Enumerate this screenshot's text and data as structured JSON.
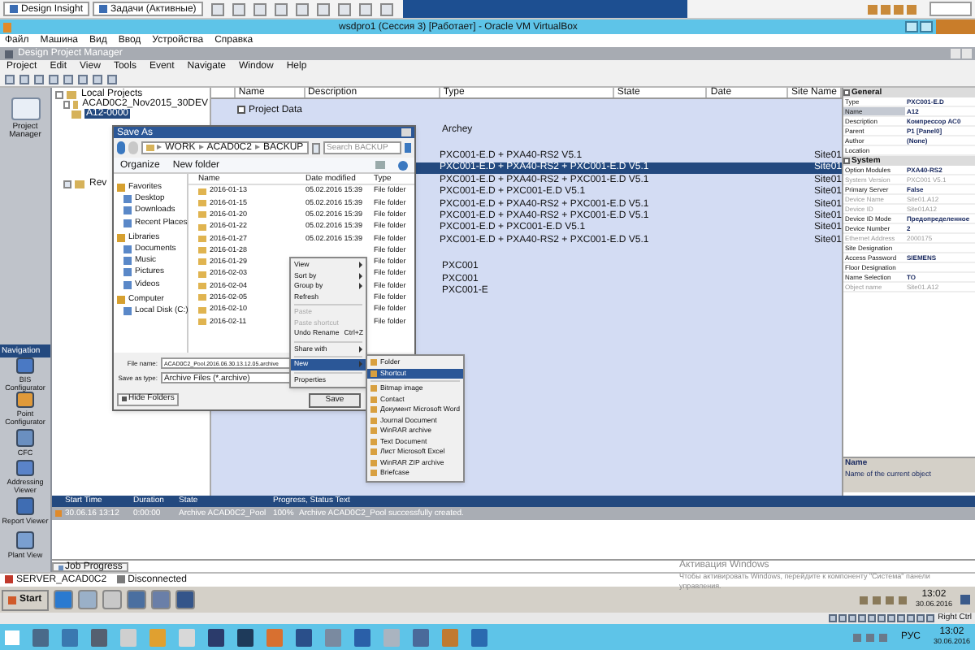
{
  "host_toolbar": {
    "buttons": [
      "Design Insight",
      "Задачи (Активные)"
    ]
  },
  "vm_window": {
    "title": "wsdpro1 (Сессия 3) [Работает] - Oracle VM VirtualBox",
    "menu": [
      "Файл",
      "Машина",
      "Вид",
      "Ввод",
      "Устройства",
      "Справка"
    ]
  },
  "app": {
    "title": "Design Project Manager",
    "menu": [
      "Project",
      "Edit",
      "View",
      "Tools",
      "Event",
      "Navigate",
      "Window",
      "Help"
    ]
  },
  "sidebar": {
    "top_item": "Project Manager",
    "title": "Navigation",
    "items": [
      "BIS Configurator",
      "Point Configurator",
      "CFC",
      "Addressing Viewer",
      "Report Viewer",
      "Plant View"
    ]
  },
  "project_tree": [
    {
      "label": "Local Projects",
      "expanded": true,
      "selected": false,
      "children": [
        {
          "label": "ACAD0C2_Nov2015_30DEV",
          "expanded": true,
          "selected": false,
          "children": [
            {
              "label": "A12-0000",
              "selected": true
            }
          ]
        },
        {
          "label": "Rev",
          "expanded": false,
          "selected": false
        }
      ]
    }
  ],
  "table": {
    "columns": [
      "Name",
      "Description",
      "Type",
      "State",
      "Date",
      "Site Name"
    ],
    "project_data": {
      "label": "Project Data",
      "checked": false
    },
    "row_groups": [
      [
        {
          "type": "Archey",
          "selected": false
        }
      ],
      [
        {
          "type": "PXC001-E.D + PXA40-RS2 V5.1",
          "site": "Site01",
          "selected": false
        },
        {
          "type": "PXC001-E.D + PXA40-RS2 + PXC001-E.D V5.1",
          "site": "Site01",
          "selected": true
        },
        {
          "type": "PXC001-E.D + PXA40-RS2 + PXC001-E.D V5.1",
          "site": "Site01",
          "selected": false
        },
        {
          "type": "PXC001-E.D + PXC001-E.D V5.1",
          "site": "Site01",
          "selected": false
        },
        {
          "type": "PXC001-E.D + PXA40-RS2 + PXC001-E.D V5.1",
          "site": "Site01",
          "selected": false
        },
        {
          "type": "PXC001-E.D + PXA40-RS2 + PXC001-E.D V5.1",
          "site": "Site01",
          "selected": false
        },
        {
          "type": "PXC001-E.D + PXC001-E.D V5.1",
          "site": "Site01",
          "selected": false
        },
        {
          "type": "PXC001-E.D + PXA40-RS2 + PXC001-E.D V5.1",
          "site": "Site01",
          "selected": false
        }
      ],
      [
        {
          "type": "PXC001",
          "selected": false
        },
        {
          "type": "PXC001",
          "selected": false
        },
        {
          "type": "PXC001-E",
          "selected": false
        }
      ]
    ]
  },
  "properties": {
    "sections": [
      {
        "title": "General",
        "expanded": true,
        "rows": [
          {
            "label": "Type",
            "value": "PXC001-E.D",
            "selected": false,
            "disabled": false
          },
          {
            "label": "Name",
            "value": "A12",
            "selected": true,
            "disabled": false
          },
          {
            "label": "Description",
            "value": "Компрессор АС0",
            "selected": false,
            "disabled": false
          },
          {
            "label": "Parent",
            "value": "P1 [Panel0]",
            "selected": false,
            "disabled": false
          },
          {
            "label": "Author",
            "value": "(None)",
            "selected": false,
            "disabled": false
          },
          {
            "label": "Location",
            "selected": false,
            "disabled": false
          }
        ]
      },
      {
        "title": "System",
        "expanded": true,
        "rows": [
          {
            "label": "Option Modules",
            "value": "PXA40-RS2",
            "selected": false,
            "disabled": false
          },
          {
            "label": "System Version",
            "value": "PXC001 V5.1",
            "selected": false,
            "disabled": true
          },
          {
            "label": "Primary Server",
            "value": "False",
            "selected": false,
            "disabled": false
          },
          {
            "label": "Device Name",
            "value": "Site01.A12",
            "selected": false,
            "disabled": true
          },
          {
            "label": "Device ID",
            "value": "Site01A12",
            "selected": false,
            "disabled": true
          },
          {
            "label": "Device ID Mode",
            "value": "Предопределенное",
            "selected": false,
            "disabled": false
          },
          {
            "label": "Device Number",
            "value": "2",
            "selected": false,
            "disabled": false
          },
          {
            "label": "Ethernet Address",
            "value": "2000175",
            "selected": false,
            "disabled": true
          },
          {
            "label": "Site Designation",
            "selected": false,
            "disabled": false
          },
          {
            "label": "Access Password",
            "value": "SIEMENS",
            "selected": false,
            "disabled": false
          },
          {
            "label": "Floor Designation",
            "selected": false,
            "disabled": false
          },
          {
            "label": "Name Selection",
            "value": "TO",
            "selected": false,
            "disabled": false
          },
          {
            "label": "Object name",
            "value": "Site01.A12",
            "selected": false,
            "disabled": true
          }
        ]
      }
    ],
    "description": {
      "title": "Name",
      "text": "Name of the current object"
    }
  },
  "save_dialog": {
    "title": "Save As",
    "path": [
      "WORK",
      "ACAD0C2",
      "BACKUP"
    ],
    "path_separator": "▸",
    "search": {
      "placeholder": "Search BACKUP"
    },
    "toolbar": [
      "Organize",
      "New folder"
    ],
    "nav": [
      {
        "label": "Favorites",
        "kind": "group"
      },
      {
        "label": "Desktop",
        "kind": "item"
      },
      {
        "label": "Downloads",
        "kind": "item"
      },
      {
        "label": "Recent Places",
        "kind": "item"
      },
      {
        "label": "Libraries",
        "kind": "group"
      },
      {
        "label": "Documents",
        "kind": "item"
      },
      {
        "label": "Music",
        "kind": "item"
      },
      {
        "label": "Pictures",
        "kind": "item"
      },
      {
        "label": "Videos",
        "kind": "item"
      },
      {
        "label": "Computer",
        "kind": "group"
      },
      {
        "label": "Local Disk (C:)",
        "kind": "item"
      }
    ],
    "columns": [
      "Name",
      "Date modified",
      "Type"
    ],
    "files": [
      {
        "name": "2016-01-13",
        "date": "05.02.2016 15:39",
        "type": "File folder"
      },
      {
        "name": "2016-01-15",
        "date": "05.02.2016 15:39",
        "type": "File folder"
      },
      {
        "name": "2016-01-20",
        "date": "05.02.2016 15:39",
        "type": "File folder"
      },
      {
        "name": "2016-01-22",
        "date": "05.02.2016 15:39",
        "type": "File folder"
      },
      {
        "name": "2016-01-27",
        "date": "05.02.2016 15:39",
        "type": "File folder"
      },
      {
        "name": "2016-01-28",
        "type": "File folder"
      },
      {
        "name": "2016-01-29",
        "type": "File folder"
      },
      {
        "name": "2016-02-03",
        "type": "File folder"
      },
      {
        "name": "2016-02-04",
        "type": "File folder"
      },
      {
        "name": "2016-02-05",
        "type": "File folder"
      },
      {
        "name": "2016-02-10",
        "type": "File folder"
      },
      {
        "name": "2016-02-11",
        "type": "File folder"
      }
    ],
    "file_name_label": "File name:",
    "file_name": "ACAD0C2_Pool.2016.06.30.13.12.05.archive",
    "type_label": "Save as type:",
    "save_type": "Archive Files (*.archive)",
    "hide_folders": "Hide Folders",
    "save": "Save"
  },
  "context_menu": [
    {
      "label": "View",
      "kind": "submenu",
      "selected": false,
      "disabled": false
    },
    {
      "label": "Sort by",
      "kind": "submenu",
      "selected": false,
      "disabled": false
    },
    {
      "label": "Group by",
      "kind": "submenu",
      "selected": false,
      "disabled": false
    },
    {
      "label": "Refresh",
      "kind": "item",
      "selected": false,
      "disabled": false
    },
    {
      "kind": "separator"
    },
    {
      "label": "Paste",
      "kind": "item",
      "selected": false,
      "disabled": true
    },
    {
      "label": "Paste shortcut",
      "kind": "item",
      "selected": false,
      "disabled": true
    },
    {
      "label": "Undo Rename",
      "shortcut": "Ctrl+Z",
      "kind": "item",
      "selected": false,
      "disabled": false
    },
    {
      "kind": "separator"
    },
    {
      "label": "Share with",
      "kind": "submenu",
      "selected": false,
      "disabled": false
    },
    {
      "kind": "separator"
    },
    {
      "label": "New",
      "kind": "submenu",
      "selected": true,
      "disabled": false
    },
    {
      "kind": "separator"
    },
    {
      "label": "Properties",
      "kind": "item",
      "selected": false,
      "disabled": false
    }
  ],
  "new_submenu": [
    {
      "label": "Folder",
      "kind": "item",
      "selected": false
    },
    {
      "label": "Shortcut",
      "kind": "item",
      "selected": true
    },
    {
      "kind": "separator"
    },
    {
      "label": "Bitmap image",
      "kind": "item",
      "selected": false
    },
    {
      "label": "Contact",
      "kind": "item",
      "selected": false
    },
    {
      "label": "Документ Microsoft Word",
      "kind": "item",
      "selected": false
    },
    {
      "label": "Journal Document",
      "kind": "item",
      "selected": false
    },
    {
      "label": "WinRAR archive",
      "kind": "item",
      "selected": false
    },
    {
      "label": "Text Document",
      "kind": "item",
      "selected": false
    },
    {
      "label": "Лист Microsoft Excel",
      "kind": "item",
      "selected": false
    },
    {
      "label": "WinRAR ZIP archive",
      "kind": "item",
      "selected": false
    },
    {
      "label": "Briefcase",
      "kind": "item",
      "selected": false
    }
  ],
  "jobs": {
    "columns": [
      "Start Time",
      "Duration",
      "State",
      "Progress, Status Text"
    ],
    "rows": [
      {
        "start": "30.06.16 13:12",
        "duration": "0:00:00",
        "state": "Archive ACAD0C2_Pool",
        "progress": "100%",
        "status": "Archive ACAD0C2_Pool successfully created."
      }
    ],
    "tab": "Job Progress"
  },
  "status_bar": [
    "SERVER_ACAD0C2",
    "Disconnected"
  ],
  "activation": {
    "title": "Активация Windows",
    "text": "Чтобы активировать Windows, перейдите к компоненту \"Система\" панели управления."
  },
  "guest_taskbar": {
    "start": "Start",
    "time": "13:02",
    "date": "30.06.2016"
  },
  "vbox_status": "Right Ctrl",
  "host_taskbar": {
    "language": "РУС",
    "time": "13:02",
    "date": "30.06.2016"
  }
}
